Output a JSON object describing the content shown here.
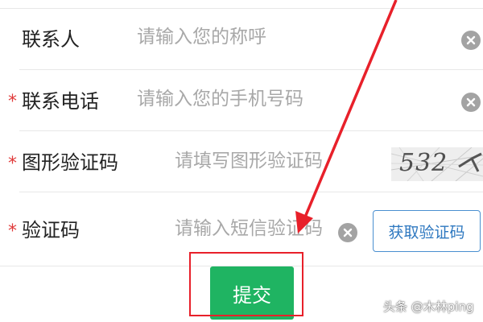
{
  "form": {
    "required_mark": "*",
    "rows": [
      {
        "label": "联系人",
        "placeholder": "请输入您的称呼",
        "required": false
      },
      {
        "label": "联系电话",
        "placeholder": "请输入您的手机号码",
        "required": true
      },
      {
        "label": "图形验证码",
        "placeholder": "请填写图形验证码",
        "required": true
      },
      {
        "label": "验证码",
        "placeholder": "请输入短信验证码",
        "required": true
      }
    ],
    "captcha_text": "532",
    "sms_button_label": "获取验证码",
    "submit_label": "提交"
  },
  "watermark": "头条 @木林ping",
  "colors": {
    "accent_green": "#1fb462",
    "required_red": "#e03a3a",
    "annotation_red": "#e8202a",
    "link_blue": "#2e78c0"
  }
}
